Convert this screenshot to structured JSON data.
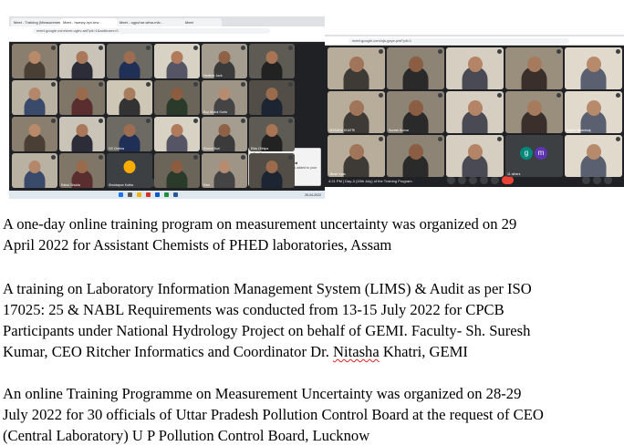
{
  "screenshot_left": {
    "tabs": [
      "Meet - Training (Measurement...",
      "Meet - hwewy-irpt-hrw",
      "Meet - ogpuhar-wfna-mfv...",
      "Meet"
    ],
    "url": "meet.google.com/wmr-ugbv-asf?pli=1&authuser=0",
    "participants": [
      "",
      "",
      "",
      "",
      "Heather Jack",
      "",
      "",
      "",
      "",
      "",
      "Boy Mukul Gurla",
      "",
      "",
      "",
      "DS Chetna",
      "",
      "Khurra Buri",
      "Ekta Chhipa",
      "",
      "Rahul Shukla",
      "Shuktapun Kotha",
      "",
      "Ravi",
      ""
    ],
    "clock": "5:20 PM | Training Unc - AIS",
    "toast": {
      "app": "OneDrive",
      "title": "Screenshot saved",
      "message": "The screenshot was added to your OneDrive."
    },
    "taskbar_time": "29-04-2022"
  },
  "screenshot_right": {
    "url": "meet.google.com/ojs-gxye-pwf?pli=1",
    "participants": [
      "",
      "",
      "",
      "",
      "",
      "NITASHA KHATRI",
      "Suresh Kumar",
      "",
      "",
      "Rajeev Bhardwaj",
      "Jitesh Vyas",
      "",
      "",
      "11 others",
      ""
    ],
    "others_initials": [
      "g",
      "m"
    ],
    "clock": "4:21 PM | Day-3 (15th July) of the Training Program"
  },
  "paragraphs": {
    "p1": {
      "lines": [
        "A one-day online training program on measurement uncertainty was organized on 29",
        "April 2022 for Assistant Chemists of PHED laboratories, Assam"
      ]
    },
    "p2": {
      "lines": [
        "A training on Laboratory Information Management System (LIMS) & Audit as per ISO",
        "17025: 25 & NABL Requirements was conducted from 13-15 July 2022 for CPCB",
        "Participants under National Hydrology Project on behalf of GEMI. Faculty- Sh. Suresh",
        "Kumar, CEO Ritcher Informatics and Coordinator Dr. Nitasha Khatri, GEMI"
      ]
    },
    "p3": {
      "lines": [
        "An online Training Programme on Measurement Uncertainty was organized on 28-29",
        "July 2022 for 30 officials of Uttar Pradesh Pollution Control Board at the request of CEO",
        "(Central Laboratory) U P Pollution Control Board, Lucknow"
      ]
    }
  }
}
